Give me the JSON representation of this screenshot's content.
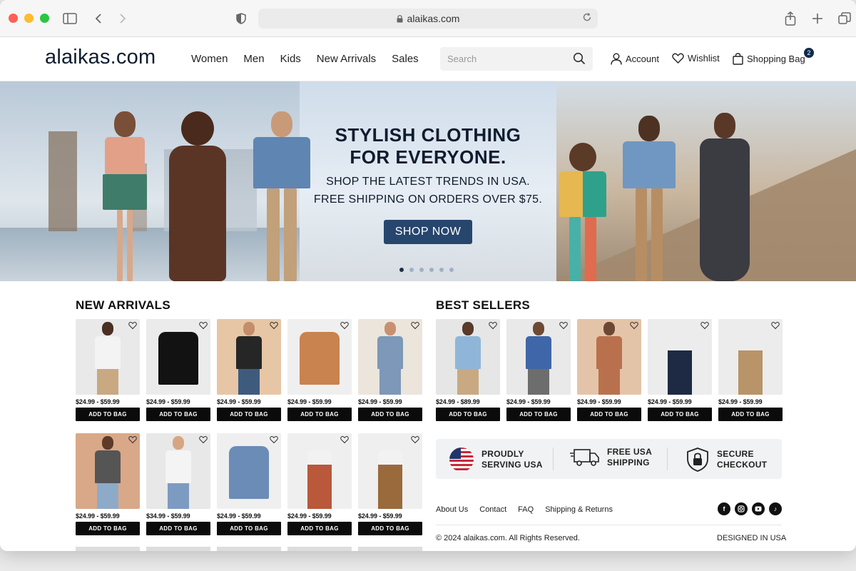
{
  "browser": {
    "url": "alaikas.com",
    "traffic_colors": [
      "#fe5f57",
      "#febc2e",
      "#28c840"
    ]
  },
  "header": {
    "logo": "alaikas.com",
    "nav": [
      "Women",
      "Men",
      "Kids",
      "New Arrivals",
      "Sales"
    ],
    "search_placeholder": "Search",
    "account": "Account",
    "wishlist": "Wishlist",
    "bag": "Shopping Bag",
    "bag_count": "2"
  },
  "hero": {
    "title_line1": "STYLISH CLOTHING",
    "title_line2": "FOR EVERYONE.",
    "sub_line1": "SHOP THE LATEST TRENDS IN USA.",
    "sub_line2": "FREE SHIPPING ON ORDERS OVER $75.",
    "cta": "SHOP NOW",
    "slide_count": 6,
    "active_slide": 1
  },
  "new_arrivals": {
    "title": "NEW ARRIVALS",
    "add_label": "ADD TO BAG",
    "items": [
      {
        "price": "$24.99 - $59.99",
        "bg": "#e9e9ea",
        "shirt": "#f3f3f3",
        "pants": "#c9a982",
        "skin": "#4a2f22"
      },
      {
        "price": "$24.99 - $59.99",
        "bg": "#ebebeb",
        "shirt": "#121212",
        "pants": "",
        "skin": ""
      },
      {
        "price": "$24.99 - $59.99",
        "bg": "#e7c6a6",
        "shirt": "#262626",
        "pants": "#3e5b7e",
        "skin": "#c48e6a"
      },
      {
        "price": "$24.99 - $59.99",
        "bg": "#efefef",
        "shirt": "#c9834f",
        "pants": "",
        "skin": ""
      },
      {
        "price": "$24.99 - $59.99",
        "bg": "#ebe5dc",
        "shirt": "#7d98b8",
        "pants": "#7d98b8",
        "skin": "#c9906f"
      },
      {
        "price": "$24.99 - $59.99",
        "bg": "#d9a888",
        "shirt": "#555555",
        "pants": "#8eaac9",
        "skin": "#5e3b29"
      },
      {
        "price": "$34.99 - $59.99",
        "bg": "#e8e8e8",
        "shirt": "#f4f4f4",
        "pants": "#7d9bc0",
        "skin": "#d6a684"
      },
      {
        "price": "$24.99 - $59.99",
        "bg": "#efefef",
        "shirt": "#6b8cb6",
        "pants": "",
        "skin": ""
      },
      {
        "price": "$24.99 - $59.99",
        "bg": "#efefef",
        "shirt": "#f2f2f2",
        "pants": "#b9583b",
        "skin": ""
      },
      {
        "price": "$24.99 - $59.99",
        "bg": "#efefef",
        "shirt": "#f2f2f2",
        "pants": "#9a6a3c",
        "skin": ""
      }
    ]
  },
  "best_sellers": {
    "title": "BEST SELLERS",
    "add_label": "ADD TO BAG",
    "items": [
      {
        "price": "$24.99 - $89.99",
        "bg": "#e6e6e6",
        "shirt": "#8fb6d8",
        "pants": "#c9a982",
        "skin": "#5a3a28"
      },
      {
        "price": "$24.99 - $59.99",
        "bg": "#e9e9e9",
        "shirt": "#3f66a8",
        "pants": "#6d6d6d",
        "skin": "#6e4a34"
      },
      {
        "price": "$24.99 - $59.99",
        "bg": "#e4c4a8",
        "shirt": "#b9714d",
        "pants": "#b9714d",
        "skin": "#6e4734"
      },
      {
        "price": "$24.99 - $59.99",
        "bg": "#ececec",
        "shirt": "#ececec",
        "pants": "#1e2a44",
        "skin": ""
      },
      {
        "price": "$24.99 - $59.99",
        "bg": "#ececec",
        "shirt": "#ececec",
        "pants": "#b89468",
        "skin": ""
      }
    ]
  },
  "trust": [
    {
      "line1": "PROUDLY",
      "line2": "SERVING USA",
      "icon": "us-flag-icon"
    },
    {
      "line1": "FREE USA",
      "line2": "SHIPPING",
      "icon": "truck-icon"
    },
    {
      "line1": "SECURE",
      "line2": "CHECKOUT",
      "icon": "shield-lock-icon"
    }
  ],
  "footer": {
    "links": [
      "About Us",
      "Contact",
      "FAQ",
      "Shipping & Returns"
    ],
    "copyright": "© 2024 alaikas.com. All Rights Reserved.",
    "designed": "DESIGNED IN USA",
    "social": [
      "facebook-icon",
      "instagram-icon",
      "youtube-icon",
      "tiktok-icon"
    ]
  }
}
